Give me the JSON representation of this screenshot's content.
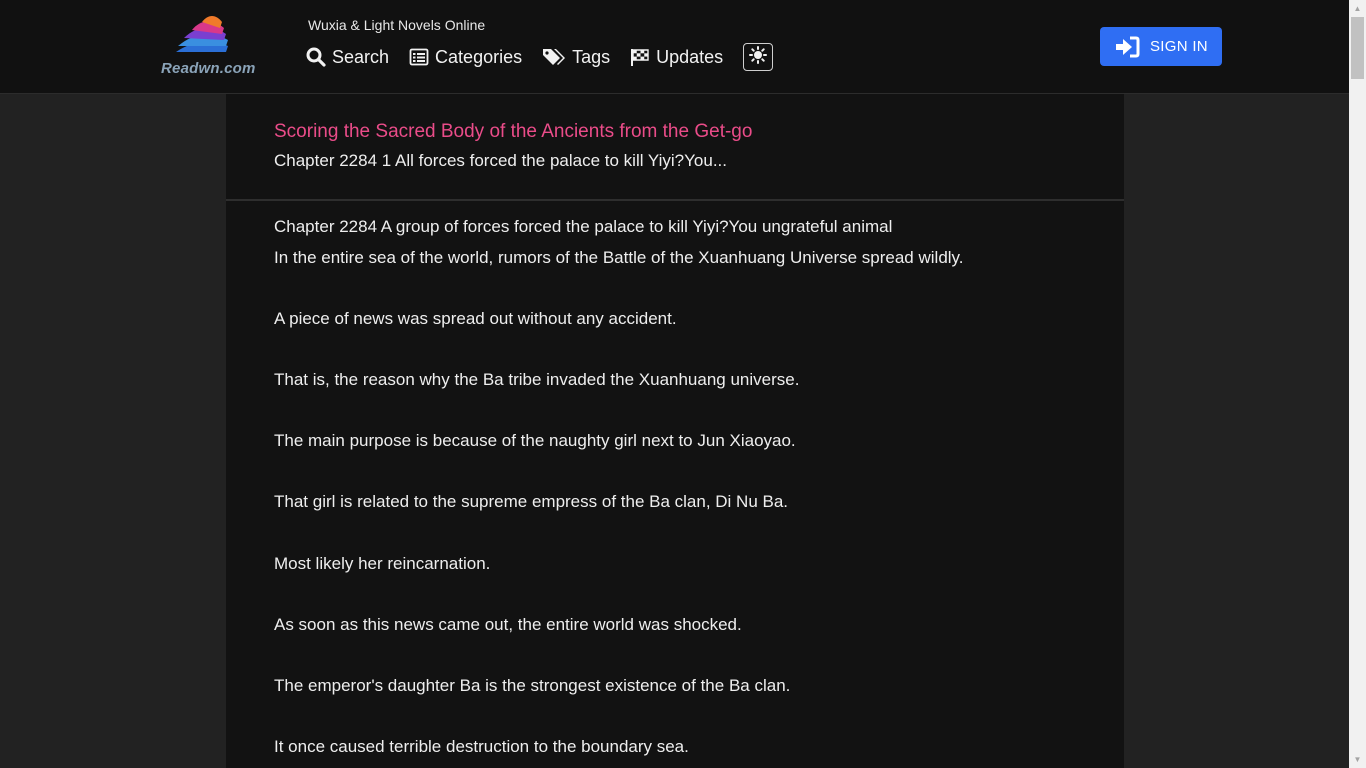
{
  "header": {
    "logo_text": "Readwn.com",
    "tagline": "Wuxia & Light Novels Online",
    "nav": [
      {
        "label": "Search",
        "icon": "search-icon"
      },
      {
        "label": "Categories",
        "icon": "list-icon"
      },
      {
        "label": "Tags",
        "icon": "tags-icon"
      },
      {
        "label": "Updates",
        "icon": "flag-checkered-icon"
      }
    ],
    "theme_toggle_icon": "sun-icon",
    "signin_label": "SIGN IN",
    "signin_icon": "sign-in-icon"
  },
  "content": {
    "novel_title": "Scoring the Sacred Body of the Ancients from the Get-go",
    "chapter_subtitle": "Chapter 2284 1 All forces forced the palace to kill Yiyi?You...",
    "paragraphs": [
      "Chapter 2284 A group of forces forced the palace to kill Yiyi?You ungrateful animal",
      "In the entire sea of the world, rumors of the Battle of the Xuanhuang Universe spread wildly.",
      "A piece of news was spread out without any accident.",
      "That is, the reason why the Ba tribe invaded the Xuanhuang universe.",
      "The main purpose is because of the naughty girl next to Jun Xiaoyao.",
      "That girl is related to the supreme empress of the Ba clan, Di Nu Ba.",
      "Most likely her reincarnation.",
      "As soon as this news came out, the entire world was shocked.",
      "The emperor's daughter Ba is the strongest existence of the Ba clan.",
      "It once caused terrible destruction to the boundary sea."
    ]
  },
  "colors": {
    "page_bg": "#222222",
    "header_bg": "#111111",
    "card_bg": "#121212",
    "title_accent": "#ea4c89",
    "signin_bg": "#2f6ef3"
  }
}
